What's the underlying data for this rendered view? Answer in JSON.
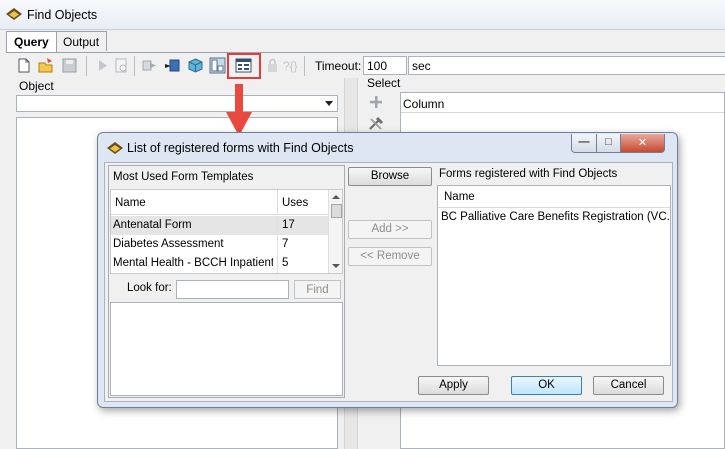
{
  "window": {
    "title": "Find Objects"
  },
  "tabs": [
    {
      "label": "Query",
      "active": true
    },
    {
      "label": "Output",
      "active": false
    }
  ],
  "toolbar": {
    "icons": [
      "new-icon",
      "open-icon",
      "save-icon",
      "run-icon",
      "preview-icon",
      "export-icon",
      "import-icon",
      "cube-icon",
      "layout-icon",
      "form-list-icon",
      "lock-icon",
      "parameters-icon"
    ],
    "highlighted_icon": "form-list-icon",
    "timeout_label": "Timeout:",
    "timeout_value": "100",
    "timeout_unit": "sec"
  },
  "object_panel": {
    "label": "Object",
    "selected": ""
  },
  "select_panel": {
    "label": "Select",
    "column_header": "Column"
  },
  "dialog": {
    "title": "List of registered forms with Find Objects",
    "most_used": {
      "title": "Most Used Form Templates",
      "columns": [
        "Name",
        "Uses"
      ],
      "rows": [
        {
          "name": "Antenatal Form",
          "uses": "17"
        },
        {
          "name": "Diabetes Assessment",
          "uses": "7"
        },
        {
          "name": "Mental Health - BCCH Inpatient...",
          "uses": "5"
        }
      ]
    },
    "look_for": {
      "label": "Look for:",
      "value": "",
      "find_label": "Find"
    },
    "middle_buttons": {
      "browse": "Browse",
      "add": "Add >>",
      "remove": "<< Remove"
    },
    "registered": {
      "title": "Forms registered with Find Objects",
      "column": "Name",
      "rows": [
        "BC Palliative Care Benefits Registration (VC..."
      ]
    },
    "footer": {
      "apply": "Apply",
      "ok": "OK",
      "cancel": "Cancel"
    }
  },
  "colors": {
    "highlight_red": "#e33d3d",
    "dialog_frame": "#dde6f2",
    "ok_button": "#bee6fd"
  }
}
